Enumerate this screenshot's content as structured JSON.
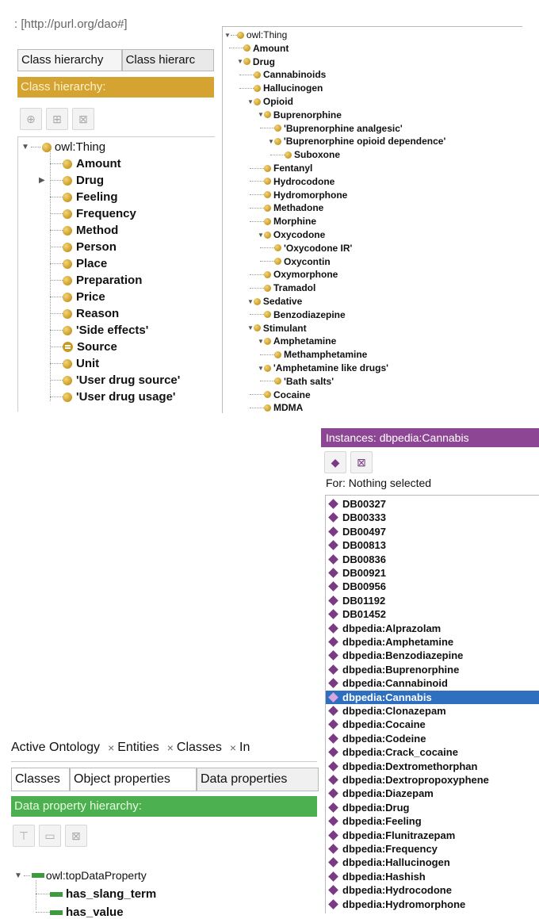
{
  "panel1": {
    "url": ": [http://purl.org/dao#]",
    "tabs": [
      "Class hierarchy",
      "Class hierarc"
    ],
    "header": "Class hierarchy:",
    "tree": {
      "root": "owl:Thing",
      "items": [
        "Amount",
        "Drug",
        "Feeling",
        "Frequency",
        "Method",
        "Person",
        "Place",
        "Preparation",
        "Price",
        "Reason",
        "'Side effects'",
        "Source",
        "Unit",
        "'User drug source'",
        "'User drug usage'"
      ]
    }
  },
  "panel2": {
    "root": "owl:Thing",
    "items": [
      {
        "label": "Amount",
        "depth": 1
      },
      {
        "label": "Drug",
        "depth": 1
      },
      {
        "label": "Cannabinoids",
        "depth": 2
      },
      {
        "label": "Hallucinogen",
        "depth": 2
      },
      {
        "label": "Opioid",
        "depth": 2
      },
      {
        "label": "Buprenorphine",
        "depth": 3
      },
      {
        "label": "'Buprenorphine analgesic'",
        "depth": 4
      },
      {
        "label": "'Buprenorphine opioid dependence'",
        "depth": 4
      },
      {
        "label": "Suboxone",
        "depth": 5
      },
      {
        "label": "Fentanyl",
        "depth": 3
      },
      {
        "label": "Hydrocodone",
        "depth": 3
      },
      {
        "label": "Hydromorphone",
        "depth": 3
      },
      {
        "label": "Methadone",
        "depth": 3
      },
      {
        "label": "Morphine",
        "depth": 3
      },
      {
        "label": "Oxycodone",
        "depth": 3
      },
      {
        "label": "'Oxycodone IR'",
        "depth": 4
      },
      {
        "label": "Oxycontin",
        "depth": 4
      },
      {
        "label": "Oxymorphone",
        "depth": 3
      },
      {
        "label": "Tramadol",
        "depth": 3
      },
      {
        "label": "Sedative",
        "depth": 2
      },
      {
        "label": "Benzodiazepine",
        "depth": 3
      },
      {
        "label": "Stimulant",
        "depth": 2
      },
      {
        "label": "Amphetamine",
        "depth": 3
      },
      {
        "label": "Methamphetamine",
        "depth": 4
      },
      {
        "label": "'Amphetamine like drugs'",
        "depth": 3
      },
      {
        "label": "'Bath salts'",
        "depth": 4
      },
      {
        "label": "Cocaine",
        "depth": 3
      },
      {
        "label": "MDMA",
        "depth": 3
      }
    ]
  },
  "panel3": {
    "header": "Instances: dbpedia:Cannabis",
    "for_label": "For: Nothing selected",
    "selected": "dbpedia:Cannabis",
    "instances": [
      "DB00327",
      "DB00333",
      "DB00497",
      "DB00813",
      "DB00836",
      "DB00921",
      "DB00956",
      "DB01192",
      "DB01452",
      "dbpedia:Alprazolam",
      "dbpedia:Amphetamine",
      "dbpedia:Benzodiazepine",
      "dbpedia:Buprenorphine",
      "dbpedia:Cannabinoid",
      "dbpedia:Cannabis",
      "dbpedia:Clonazepam",
      "dbpedia:Cocaine",
      "dbpedia:Codeine",
      "dbpedia:Crack_cocaine",
      "dbpedia:Dextromethorphan",
      "dbpedia:Dextropropoxyphene",
      "dbpedia:Diazepam",
      "dbpedia:Drug",
      "dbpedia:Feeling",
      "dbpedia:Flunitrazepam",
      "dbpedia:Frequency",
      "dbpedia:Hallucinogen",
      "dbpedia:Hashish",
      "dbpedia:Hydrocodone",
      "dbpedia:Hydromorphone"
    ]
  },
  "panel4": {
    "top_tabs": [
      "Active Ontology",
      "Entities",
      "Classes",
      "In"
    ],
    "sub_tabs": [
      "Classes",
      "Object properties",
      "Data properties"
    ],
    "header": "Data property hierarchy:",
    "root": "owl:topDataProperty",
    "items": [
      "has_slang_term",
      "has_value"
    ]
  },
  "colors": {
    "class_header": "#d4a332",
    "instances_header": "#8d4693",
    "data_header": "#4caf50",
    "selection": "#2f6fbf"
  }
}
